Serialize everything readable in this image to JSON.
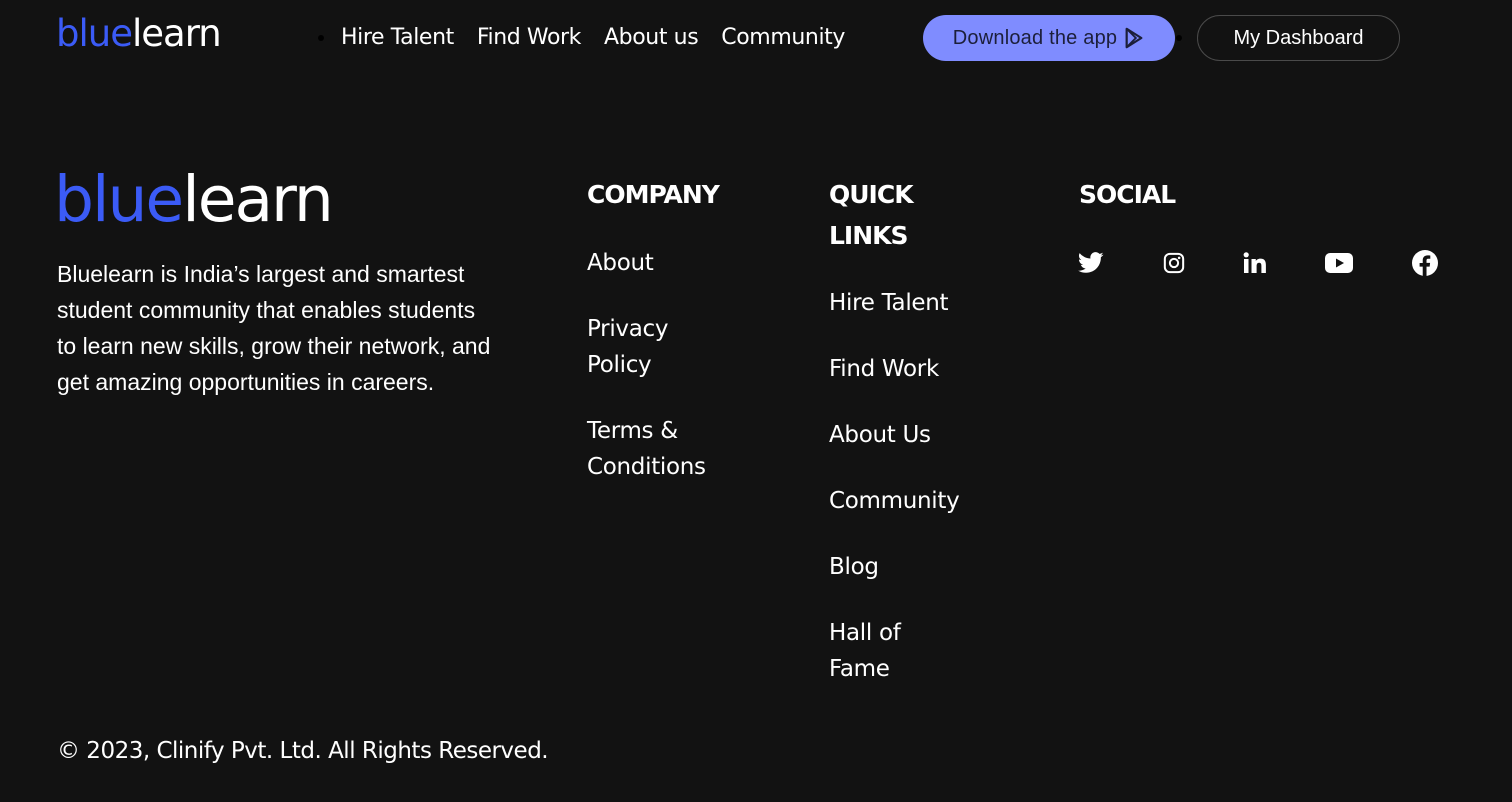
{
  "brand": {
    "part1": "blue",
    "part2": "learn"
  },
  "nav": {
    "links": [
      "Hire Talent",
      "Find Work",
      "About us",
      "Community"
    ],
    "download_label": "Download the app",
    "dashboard_label": "My Dashboard"
  },
  "footer": {
    "about_text": "Bluelearn is India’s largest and smartest student community that enables students to learn new skills, grow their network, and get amazing opportunities in careers.",
    "company": {
      "heading": "COMPANY",
      "links": [
        "About",
        "Privacy Policy",
        "Terms & Conditions"
      ]
    },
    "quick_links": {
      "heading": "QUICK LINKS",
      "links": [
        "Hire Talent",
        "Find Work",
        "About Us",
        "Community",
        "Blog",
        "Hall of Fame"
      ]
    },
    "social": {
      "heading": "SOCIAL",
      "icons": [
        "twitter-icon",
        "instagram-icon",
        "linkedin-icon",
        "youtube-icon",
        "facebook-icon"
      ]
    },
    "copyright": "© 2023, Clinify Pvt. Ltd. All Rights Reserved."
  },
  "colors": {
    "background": "#121212",
    "brand_blue": "#3b5bf6",
    "download_button": "#7f8cff"
  }
}
